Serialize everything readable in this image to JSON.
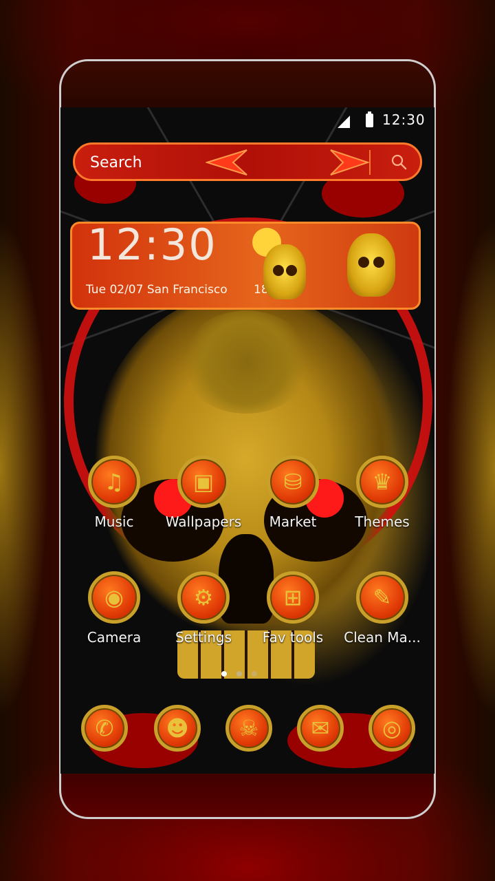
{
  "status_bar": {
    "time": "12:30"
  },
  "search": {
    "placeholder": "Search"
  },
  "clock_widget": {
    "time": "12:30",
    "date": "Tue  02/07  San Francisco",
    "temperature": "18°C"
  },
  "apps_row1": [
    {
      "label": "Music",
      "icon": "music-note-icon",
      "glyph": "♫"
    },
    {
      "label": "Wallpapers",
      "icon": "image-icon",
      "glyph": "▣"
    },
    {
      "label": "Market",
      "icon": "shopping-bag-icon",
      "glyph": "⛁"
    },
    {
      "label": "Themes",
      "icon": "tshirt-icon",
      "glyph": "♛"
    }
  ],
  "apps_row2": [
    {
      "label": "Camera",
      "icon": "camera-icon",
      "glyph": "◉"
    },
    {
      "label": "Settings",
      "icon": "gear-icon",
      "glyph": "⚙"
    },
    {
      "label": "Fav tools",
      "icon": "grid-icon",
      "glyph": "⊞"
    },
    {
      "label": "Clean Ma...",
      "icon": "broom-icon",
      "glyph": "✎"
    }
  ],
  "dock": [
    {
      "icon": "phone-icon",
      "glyph": "✆"
    },
    {
      "icon": "contacts-icon",
      "glyph": "☻"
    },
    {
      "icon": "skull-icon",
      "glyph": "☠"
    },
    {
      "icon": "messages-icon",
      "glyph": "✉"
    },
    {
      "icon": "browser-globe-icon",
      "glyph": "◎"
    }
  ],
  "page_indicator": {
    "pages": 3,
    "active": 1
  },
  "colors": {
    "accent": "#d41010",
    "gold": "#c9a12a",
    "orange": "#e6661c"
  }
}
